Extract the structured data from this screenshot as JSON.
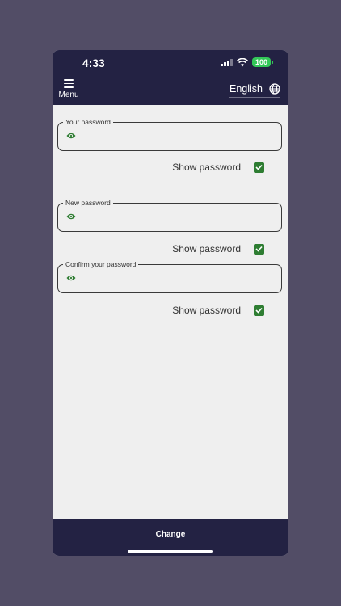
{
  "status": {
    "time": "4:33",
    "battery": "100"
  },
  "header": {
    "menu_label": "Menu",
    "language": "English"
  },
  "form": {
    "current_password": {
      "label": "Your password",
      "show_label": "Show password",
      "show_checked": true
    },
    "new_password": {
      "label": "New password",
      "show_label": "Show password",
      "show_checked": true
    },
    "confirm_password": {
      "label": "Confirm your password",
      "show_label": "Show password",
      "show_checked": true
    }
  },
  "footer": {
    "change_label": "Change"
  },
  "colors": {
    "accent": "#2e7d32",
    "bar": "#232243",
    "background": "#efefef",
    "outer": "#524d66"
  }
}
